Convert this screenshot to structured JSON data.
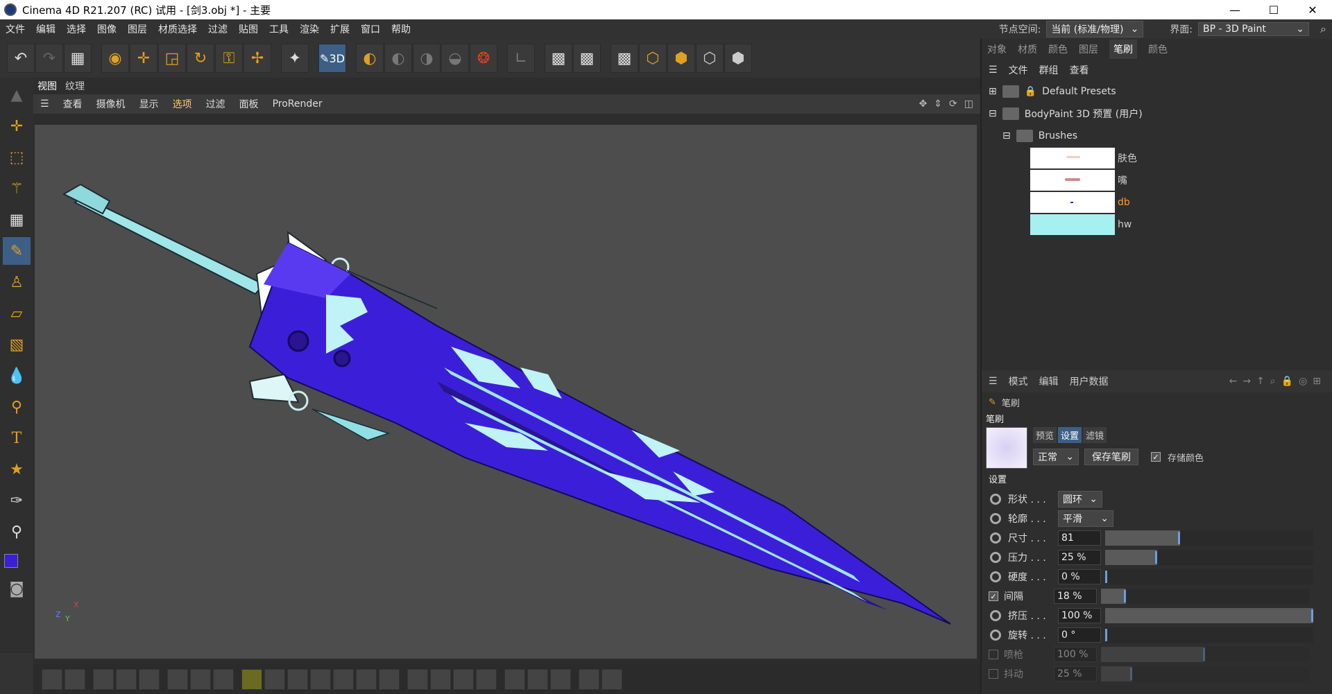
{
  "titlebar": {
    "title": "Cinema 4D R21.207 (RC) 试用 - [剑3.obj *] - 主要",
    "minimize": "—",
    "maximize": "☐",
    "close": "✕"
  },
  "menu": [
    "文件",
    "编辑",
    "选择",
    "图像",
    "图层",
    "材质选择",
    "过滤",
    "贴图",
    "工具",
    "渲染",
    "扩展",
    "窗口",
    "帮助"
  ],
  "menu_right": {
    "node_space_label": "节点空间:",
    "node_space_value": "当前 (标准/物理)",
    "layout_label": "界面:",
    "layout_value": "BP - 3D Paint"
  },
  "viewport": {
    "tabs": [
      "视图",
      "纹理"
    ],
    "menu": [
      "查看",
      "摄像机",
      "显示",
      "选项",
      "过滤",
      "面板",
      "ProRender"
    ],
    "axis_x": "X",
    "axis_y": "Y",
    "axis_z": "Z"
  },
  "right_panel": {
    "tabs": [
      "对象",
      "材质",
      "颜色",
      "图层",
      "笔刷",
      "颜色"
    ],
    "active_tab": "笔刷",
    "menu": [
      "文件",
      "群组",
      "查看"
    ],
    "tree": {
      "default_presets": "Default Presets",
      "user_presets": "BodyPaint 3D 预置 (用户)",
      "brushes_folder": "Brushes",
      "brushes": [
        {
          "name": "肤色",
          "active": false
        },
        {
          "name": "嘴",
          "active": false
        },
        {
          "name": "db",
          "active": true
        },
        {
          "name": "hw",
          "active": false
        }
      ]
    }
  },
  "attributes": {
    "menu": [
      "模式",
      "编辑",
      "用户数据"
    ],
    "object_label": "笔刷",
    "section_label": "笔刷",
    "tabs": [
      "预览",
      "设置",
      "滤镜"
    ],
    "active_tab": "设置",
    "blend_mode": "正常",
    "save_brush": "保存笔刷",
    "store_color": "存储颜色",
    "settings_header": "设置",
    "shape_label": "形状 . . .",
    "shape_value": "圆环",
    "profile_label": "轮廓 . . .",
    "profile_value": "平滑",
    "params": [
      {
        "label": "尺寸 . . .",
        "value": "81",
        "fraction": 0.36,
        "kind": "radio",
        "dim": false
      },
      {
        "label": "压力 . . .",
        "value": "25 %",
        "fraction": 0.25,
        "kind": "radio",
        "dim": false
      },
      {
        "label": "硬度 . . .",
        "value": "0 %",
        "fraction": 0.0,
        "kind": "radio",
        "dim": false
      },
      {
        "label": "间隔",
        "value": "18 %",
        "fraction": 0.12,
        "kind": "check",
        "dim": false
      },
      {
        "label": "挤压 . . .",
        "value": "100 %",
        "fraction": 1.0,
        "kind": "radio",
        "dim": false
      },
      {
        "label": "旋转 . . .",
        "value": "0 °",
        "fraction": 0.0,
        "kind": "radio",
        "dim": false
      },
      {
        "label": "喷枪",
        "value": "100 %",
        "fraction": 0.5,
        "kind": "check",
        "dim": true
      },
      {
        "label": "抖动",
        "value": "25 %",
        "fraction": 0.15,
        "kind": "check",
        "dim": true
      }
    ]
  },
  "colors": {
    "accent": "#3d5f86",
    "sword_blade": "#3b1fd8",
    "sword_glow": "#a6f0f2"
  }
}
